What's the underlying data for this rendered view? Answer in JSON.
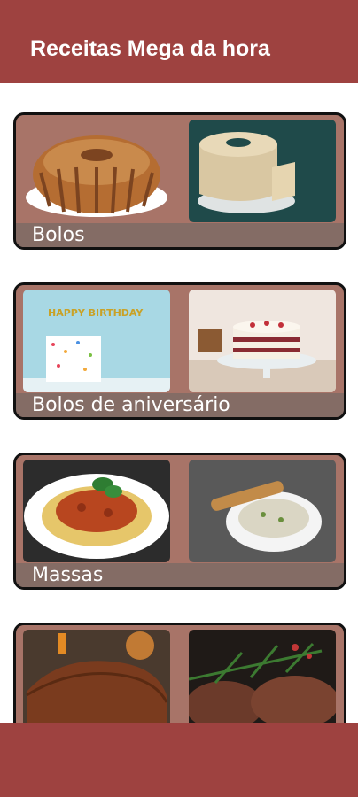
{
  "app": {
    "title": "Receitas Mega da hora"
  },
  "categories": [
    {
      "label": "Bolos",
      "left_image": "bundt-cake-photo",
      "right_image": "chiffon-cake-photo"
    },
    {
      "label": "Bolos de aniversário",
      "left_image": "birthday-cake-photo",
      "right_image": "layer-cake-photo",
      "cake_topper_text": "HAPPY BIRTHDAY"
    },
    {
      "label": "Massas",
      "left_image": "spaghetti-bolognese-photo",
      "right_image": "creamy-pasta-photo"
    },
    {
      "label": "",
      "left_image": "meatloaf-photo",
      "right_image": "steak-photo"
    }
  ],
  "colors": {
    "appbar": "#9e4240",
    "card_background": "#a87468",
    "card_border": "#111111"
  }
}
